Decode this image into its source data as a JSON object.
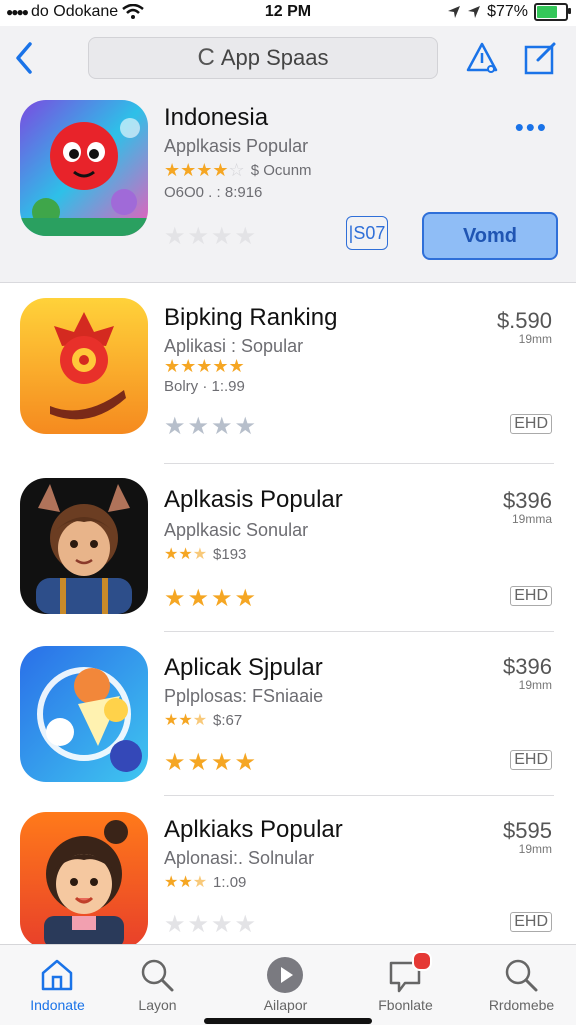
{
  "status_bar": {
    "carrier": "do Odokane",
    "time": "12 PM",
    "battery": "$77%",
    "battery_level": 0.77
  },
  "nav": {
    "search_label": "App Spaas"
  },
  "featured": {
    "title": "Indonesia",
    "subtitle": "Applkasis Popular",
    "meta_text": "$ Ocunm",
    "date": "O6O0 . : 8:916",
    "secondary_button": "|S07",
    "primary_button": "Vomd"
  },
  "apps": [
    {
      "title": "Bipking Ranking",
      "subtitle": "Aplikasi : Sopular",
      "meta": "Bolry · 1:.99",
      "price": "$.590",
      "size": "19mm",
      "get_label": "EHD"
    },
    {
      "title": "Aplkasis Popular",
      "subtitle": "Applkasic Sonular",
      "meta": "$193",
      "price": "$396",
      "size": "19mma",
      "get_label": "EHD"
    },
    {
      "title": "Aplicak Sjpular",
      "subtitle": "Pplplosas: FSniaaie",
      "meta": "$:67",
      "price": "$396",
      "size": "19mm",
      "get_label": "EHD"
    },
    {
      "title": "Aplkiaks Popular",
      "subtitle": "Aplonasi:. Solnular",
      "meta": "1:.09",
      "price": "$595",
      "size": "19mm",
      "get_label": "EHD"
    }
  ],
  "tabs": [
    {
      "label": "Indonate",
      "icon": "home-icon",
      "active": true
    },
    {
      "label": "Layon",
      "icon": "search-icon"
    },
    {
      "label": "Ailapor",
      "icon": "play-icon"
    },
    {
      "label": "Fbonlate",
      "icon": "notification-icon"
    },
    {
      "label": "Rrdomebe",
      "icon": "search-icon"
    }
  ],
  "colors": {
    "accent": "#1a73e8",
    "star": "#f5a623",
    "battery": "#34c759"
  }
}
